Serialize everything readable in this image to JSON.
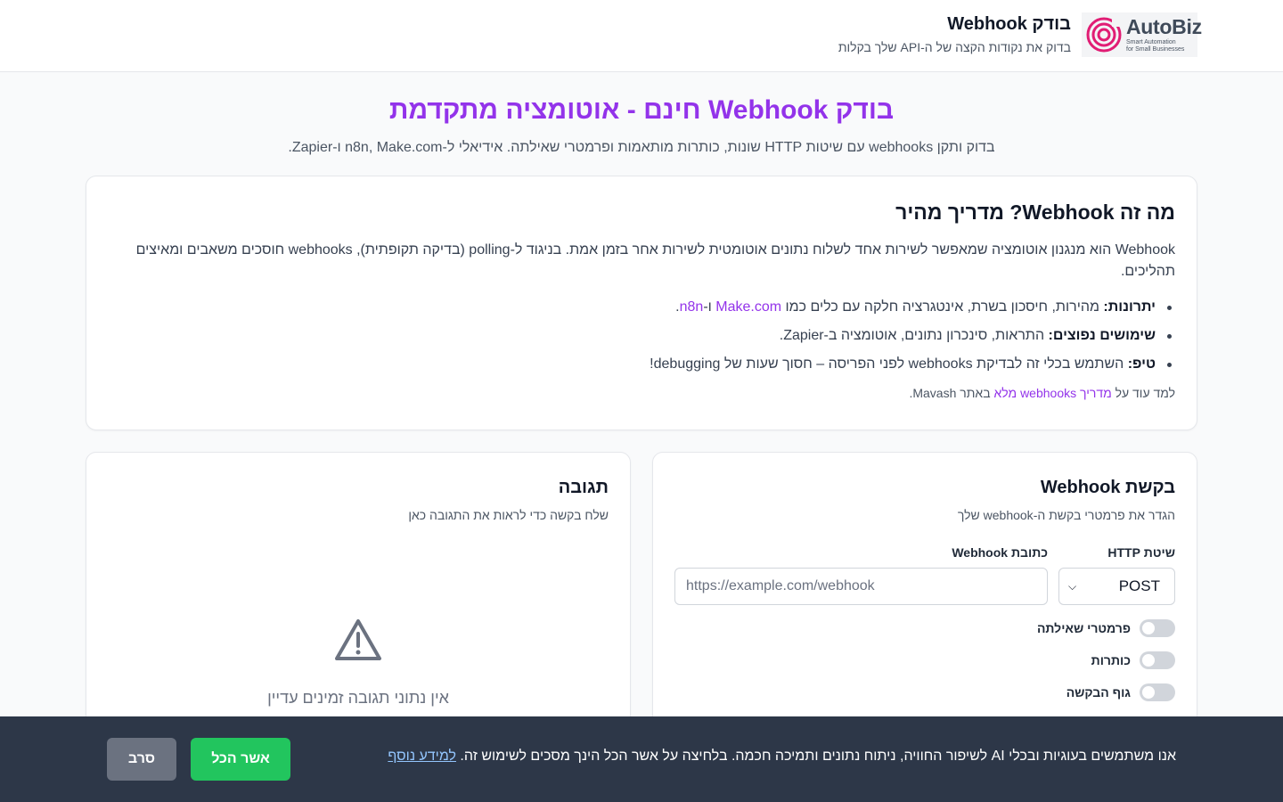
{
  "header": {
    "logo": {
      "name": "AutoBiz",
      "tagline_line1": "Smart Automation",
      "tagline_line2": "for Small Businesses",
      "accent": "#e11d74"
    },
    "title": "בודק Webhook",
    "subtitle": "בדוק את נקודות הקצה של ה-API שלך בקלות"
  },
  "hero": {
    "title": "בודק Webhook חינם - אוטומציה מתקדמת",
    "subtitle": "בדוק ותקן webhooks עם שיטות HTTP שונות, כותרות מותאמות ופרמטרי שאילתה. אידיאלי ל-n8n, Make.com ו-Zapier."
  },
  "guide": {
    "title": "מה זה Webhook? מדריך מהיר",
    "intro": "Webhook הוא מנגנון אוטומציה שמאפשר לשירות אחד לשלוח נתונים אוטומטית לשירות אחר בזמן אמת. בניגוד ל-polling (בדיקה תקופתית), webhooks חוסכים משאבים ומאיצים תהליכים.",
    "bullets": [
      {
        "label": "יתרונות:",
        "text_before": " מהירות, חיסכון בשרת, אינטגרציה חלקה עם כלים כמו ",
        "link1": "Make.com",
        "mid": " ו-",
        "link2": "n8n",
        "text_after": "."
      },
      {
        "label": "שימושים נפוצים:",
        "text": " התראות, סינכרון נתונים, אוטומציה ב-Zapier."
      },
      {
        "label": "טיפ:",
        "text": " השתמש בכלי זה לבדיקת webhooks לפני הפריסה – חסוך שעות של debugging!"
      }
    ],
    "more_prefix": "למד עוד על ",
    "more_link": "מדריך webhooks מלא",
    "more_suffix": " באתר Mavash."
  },
  "request": {
    "title": "בקשת Webhook",
    "subtitle": "הגדר את פרמטרי בקשת ה-webhook שלך",
    "method_label": "שיטת HTTP",
    "method_value": "POST",
    "url_label": "כתובת Webhook",
    "url_placeholder": "https://example.com/webhook",
    "toggles": [
      "פרמטרי שאילתה",
      "כותרות",
      "גוף הבקשה"
    ]
  },
  "response": {
    "title": "תגובה",
    "subtitle": "שלח בקשה כדי לראות את התגובה כאן",
    "empty_icon": "warning-triangle-icon",
    "empty_text": "אין נתוני תגובה זמינים עדיין"
  },
  "cookie": {
    "text": "אנו משתמשים בעוגיות ובכלי AI לשיפור החוויה, ניתוח נתונים ותמיכה חכמה. בלחיצה על אשר הכל הינך מסכים לשימוש זה. ",
    "link": "למידע נוסף",
    "accept": "אשר הכל",
    "decline": "סרב"
  },
  "colors": {
    "brand_purple": "#9333ea",
    "accept_green": "#22c55e",
    "cookie_bg": "#2d3748"
  }
}
